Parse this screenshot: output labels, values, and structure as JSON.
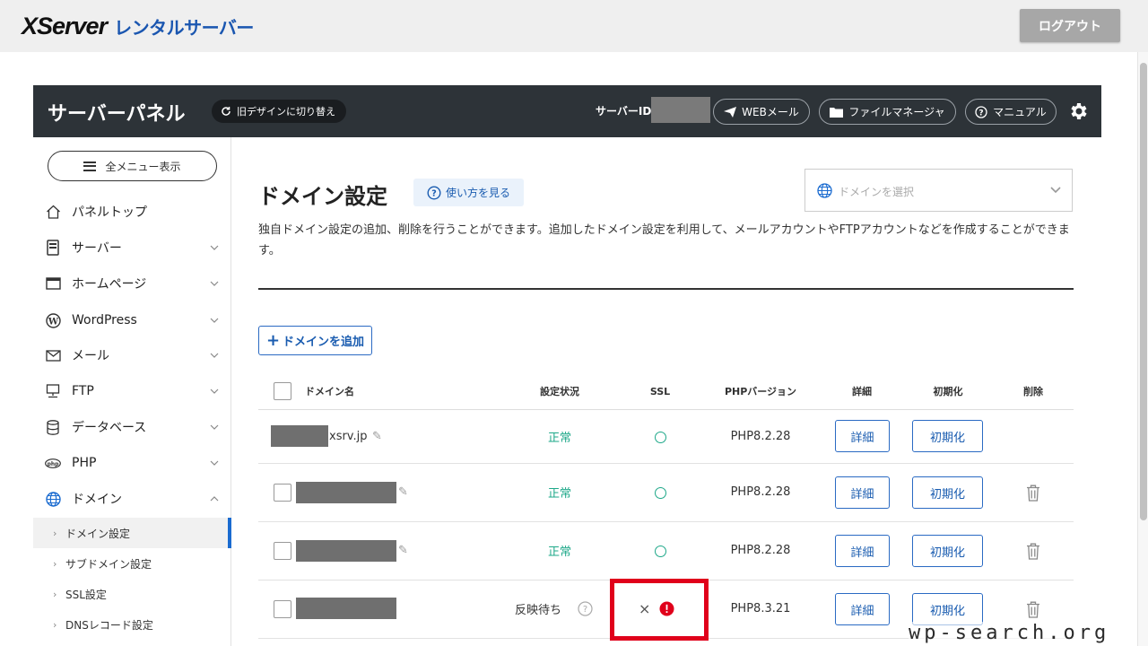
{
  "topbar": {
    "logo_main": "XServer",
    "logo_sub": "レンタルサーバー",
    "logout_label": "ログアウト"
  },
  "panel_header": {
    "title": "サーバーパネル",
    "old_design_label": "旧デザインに切り替え",
    "server_id_label": "サーバーID",
    "webmail_label": "WEBメール",
    "file_manager_label": "ファイルマネージャ",
    "manual_label": "マニュアル"
  },
  "sidebar": {
    "all_menu_label": "全メニュー表示",
    "items": [
      {
        "label": "パネルトップ",
        "icon": "home-icon"
      },
      {
        "label": "サーバー",
        "icon": "server-icon"
      },
      {
        "label": "ホームページ",
        "icon": "browser-icon"
      },
      {
        "label": "WordPress",
        "icon": "wordpress-icon"
      },
      {
        "label": "メール",
        "icon": "mail-icon"
      },
      {
        "label": "FTP",
        "icon": "ftp-icon"
      },
      {
        "label": "データベース",
        "icon": "database-icon"
      },
      {
        "label": "PHP",
        "icon": "php-icon"
      },
      {
        "label": "ドメイン",
        "icon": "globe-icon"
      }
    ],
    "sub_items": [
      {
        "label": "ドメイン設定"
      },
      {
        "label": "サブドメイン設定"
      },
      {
        "label": "SSL設定"
      },
      {
        "label": "DNSレコード設定"
      }
    ]
  },
  "main": {
    "title": "ドメイン設定",
    "howto_label": "使い方を見る",
    "domain_select_placeholder": "ドメインを選択",
    "description": "独自ドメイン設定の追加、削除を行うことができます。追加したドメイン設定を利用して、メールアカウントやFTPアカウントなどを作成することができます。",
    "add_domain_label": "ドメインを追加"
  },
  "table": {
    "headers": {
      "domain": "ドメイン名",
      "status": "設定状況",
      "ssl": "SSL",
      "php": "PHPバージョン",
      "detail": "詳細",
      "init": "初期化",
      "delete": "削除"
    },
    "rows": [
      {
        "domain": "xsrv.jp",
        "status": "正常",
        "php": "PHP8.2.28",
        "detail": "詳細",
        "init": "初期化"
      },
      {
        "domain": "",
        "status": "正常",
        "php": "PHP8.2.28",
        "detail": "詳細",
        "init": "初期化"
      },
      {
        "domain": "",
        "status": "正常",
        "php": "PHP8.2.28",
        "detail": "詳細",
        "init": "初期化"
      },
      {
        "domain": "",
        "status": "反映待ち",
        "php": "PHP8.3.21",
        "detail": "詳細",
        "init": "初期化",
        "ssl_mark": "×"
      }
    ]
  },
  "watermark": "wp-search.org",
  "colors": {
    "header_bg": "#2d3338",
    "accent": "#1a6bd0",
    "status_ok": "#1ea889",
    "alert_red": "#e0001b"
  }
}
